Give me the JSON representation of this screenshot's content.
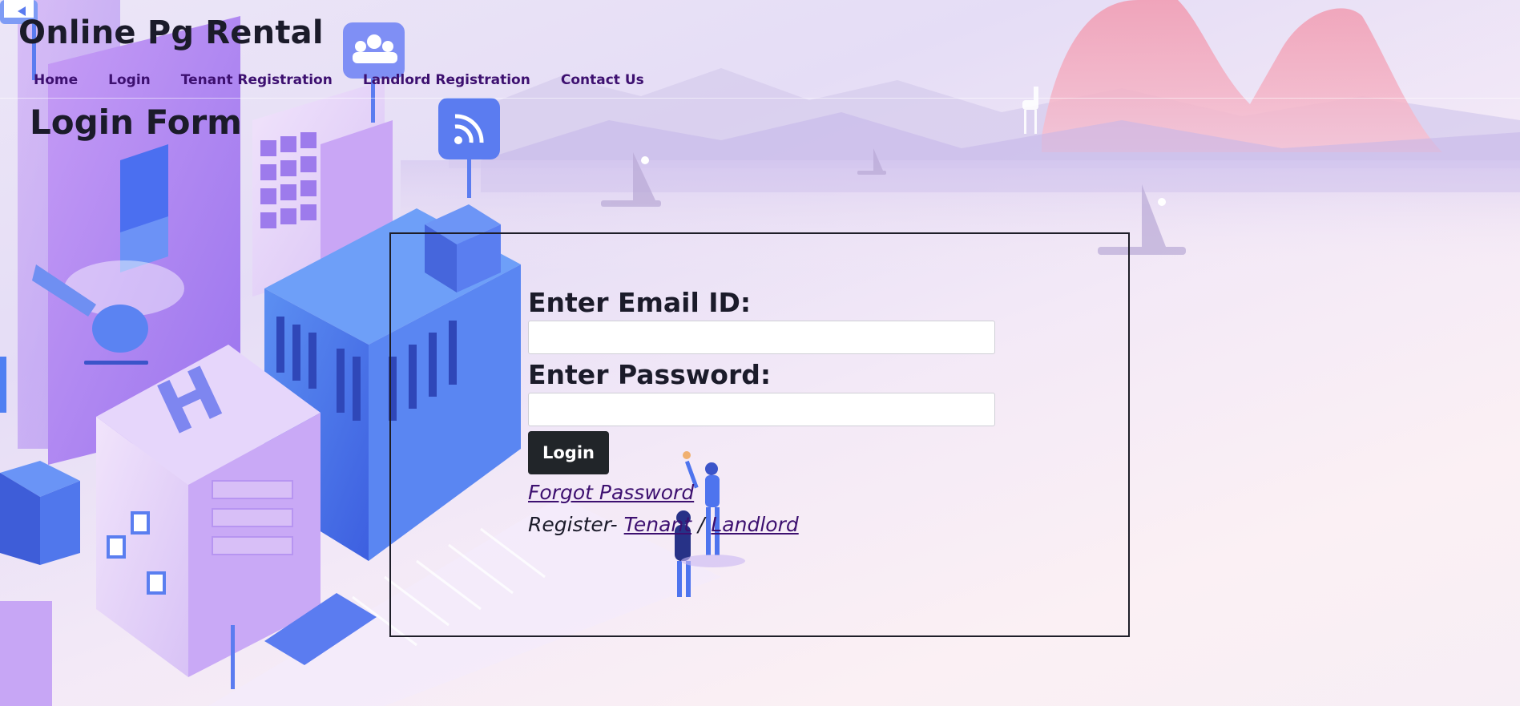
{
  "site": {
    "title": "Online Pg Rental"
  },
  "nav": {
    "items": [
      {
        "label": "Home"
      },
      {
        "label": "Login"
      },
      {
        "label": "Tenant Registration"
      },
      {
        "label": "Landlord Registration"
      },
      {
        "label": "Contact Us"
      }
    ]
  },
  "page": {
    "title": "Login Form"
  },
  "form": {
    "email_label": "Enter Email ID:",
    "email_value": "",
    "password_label": "Enter Password:",
    "password_value": "",
    "login_button": "Login",
    "forgot_link": "Forgot Password",
    "register_prefix": "Register- ",
    "register_tenant": "Tenant",
    "register_separator": " / ",
    "register_landlord": "Landlord"
  },
  "icons": {
    "group": "users-icon",
    "rss": "rss-icon",
    "video": "video-icon"
  },
  "colors": {
    "link": "#3d1070",
    "button": "#212529",
    "accent_blue": "#5b7cf0",
    "accent_purple": "#a98af0"
  }
}
